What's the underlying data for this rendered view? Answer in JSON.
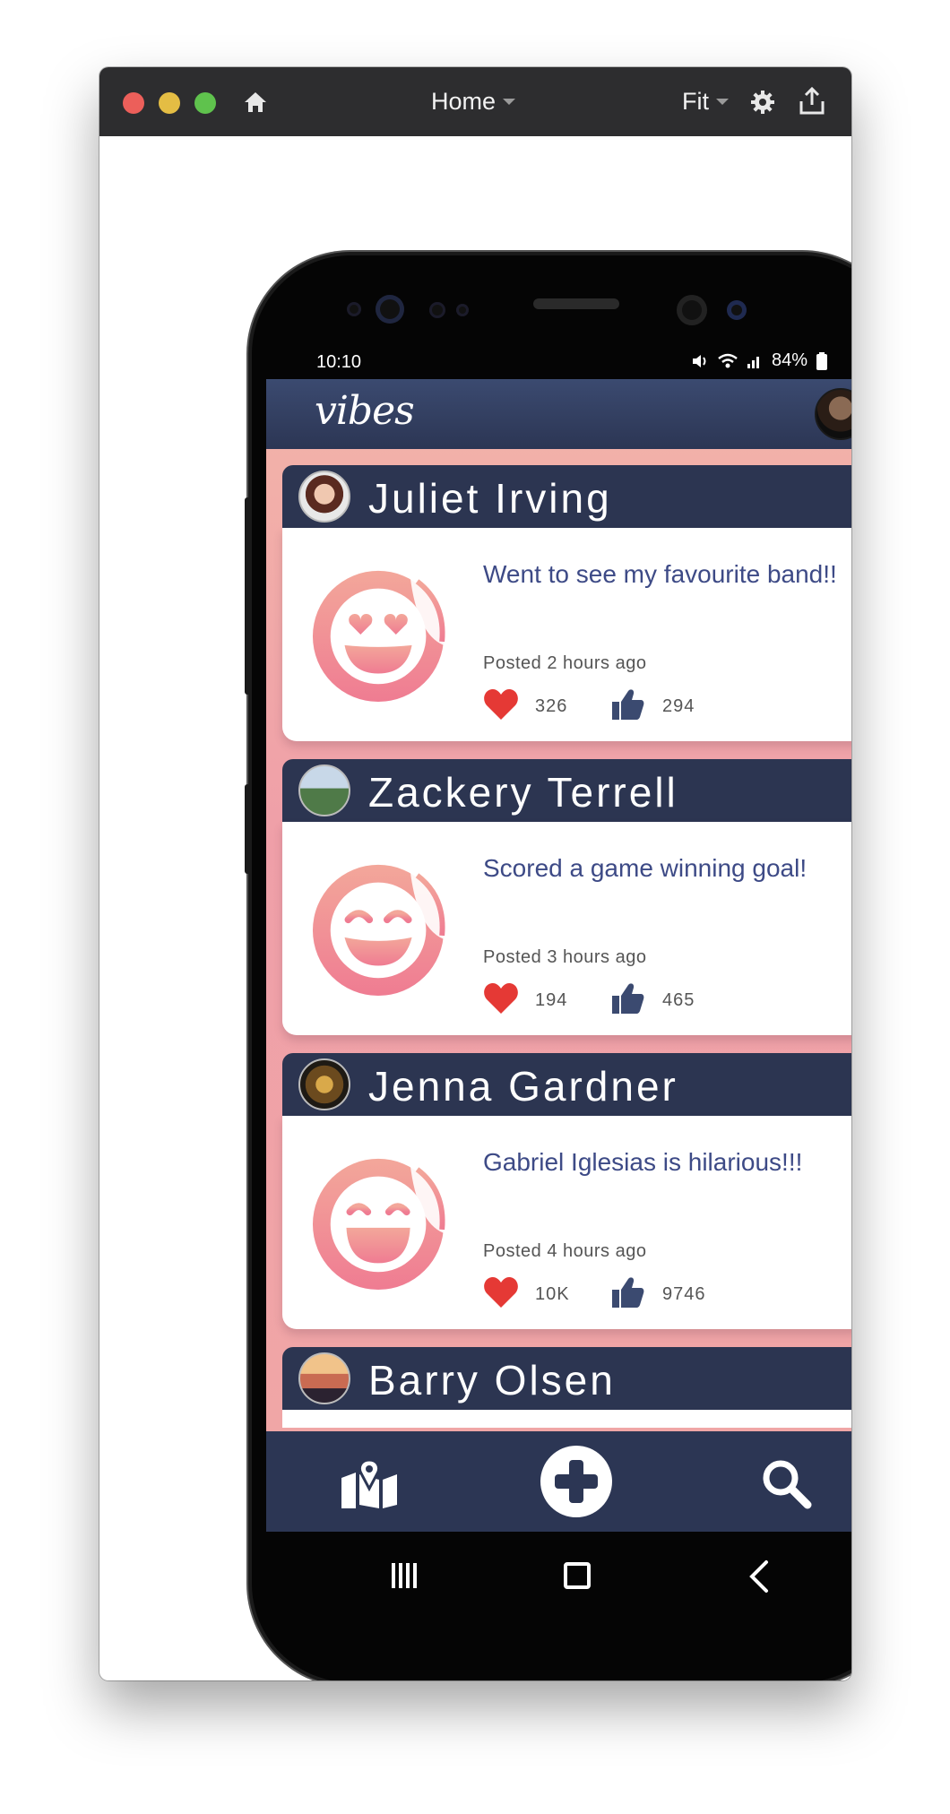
{
  "window": {
    "title": "Home",
    "zoom": "Fit"
  },
  "status_bar": {
    "time": "10:10",
    "battery": "84%"
  },
  "app": {
    "logo": "vibes"
  },
  "posts": [
    {
      "name": "Juliet Irving",
      "text": "Went to see my favourite band!!",
      "posted": "Posted 2 hours ago",
      "hearts": "326",
      "likes": "294",
      "sticker": "heart-eyes-emoji"
    },
    {
      "name": "Zackery Terrell",
      "text": "Scored a game winning goal!",
      "posted": "Posted 3 hours ago",
      "hearts": "194",
      "likes": "465",
      "sticker": "smiling-eyes-emoji"
    },
    {
      "name": "Jenna Gardner",
      "text": "Gabriel Iglesias is hilarious!!!",
      "posted": "Posted 4 hours ago",
      "hearts": "10K",
      "likes": "9746",
      "sticker": "grinning-emoji"
    },
    {
      "name": "Barry Olsen"
    }
  ],
  "colors": {
    "accent_navy": "#2c3654",
    "post_text": "#3d4a86",
    "heart": "#e53935",
    "thumb": "#3b4a70",
    "sticker_gradient": [
      "#f3a79a",
      "#ef7c92"
    ]
  },
  "icons": {
    "nav_left": "map-icon",
    "nav_center": "add-icon",
    "nav_right": "search-icon"
  }
}
